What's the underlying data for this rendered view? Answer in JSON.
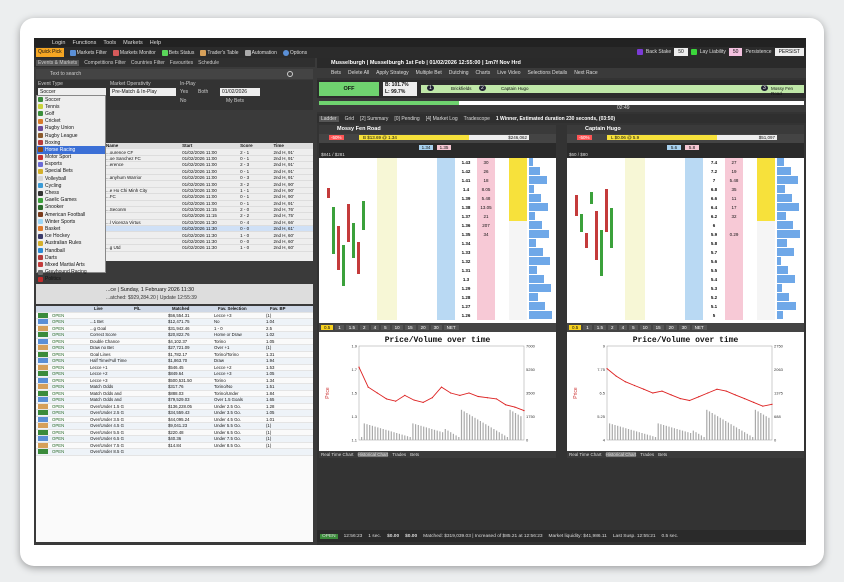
{
  "menu": [
    "Login",
    "Functions",
    "Tools",
    "Markets",
    "Help"
  ],
  "toolbar": {
    "items": [
      "Quick Pick",
      "Markets Filter",
      "Markets Monitor",
      "Bets Status",
      "Trader's Table",
      "Automation",
      "Options"
    ],
    "back_stake_label": "Back Stake",
    "back_stake": "50",
    "lay_liability_label": "Lay Liability",
    "lay_liability": "50",
    "persistence_label": "Persistence",
    "persistence": "PERSIST"
  },
  "left_tabs": [
    "Events & Markets",
    "Competitions Filter",
    "Countries Filter",
    "Favourites",
    "Schedule"
  ],
  "search_placeholder": "Text to search",
  "filters": {
    "event_type_label": "Event Type",
    "event_type": "Soccer",
    "operativity_label": "Market Operativity",
    "operativity": "Pre-Match & In-Play",
    "inplay_label": "In-Play",
    "inplay_options": [
      "Yes",
      "Both",
      "No"
    ],
    "date": "01/02/2026",
    "my_bets": "My Bets"
  },
  "event_types": [
    "Soccer",
    "Tennis",
    "Golf",
    "Cricket",
    "Rugby Union",
    "Rugby League",
    "Boxing",
    "Horse Racing",
    "Motor Sport",
    "Esports",
    "Special Bets",
    "Volleyball",
    "Cycling",
    "Chess",
    "Gaelic Games",
    "Snooker",
    "American Football",
    "Winter Sports",
    "Basket",
    "Ice Hockey",
    "Australian Rules",
    "Handball",
    "Darts",
    "Mixed Martial Arts",
    "Greyhound Racing",
    "Politics"
  ],
  "event_colors": [
    "#3b8b3b",
    "#c9d23b",
    "#3a8e3a",
    "#d87b2b",
    "#6b4a9b",
    "#8b5a2b",
    "#b83b3b",
    "#8b4513",
    "#c43131",
    "#6a6ad6",
    "#d4b02b",
    "#d6d6d6",
    "#3b9bd6",
    "#333333",
    "#3ba13b",
    "#2b6b2b",
    "#7b3b1b",
    "#9bd6f6",
    "#e07b2b",
    "#3b3b6b",
    "#d6b02b",
    "#2b8bd6",
    "#b33b3b",
    "#c43b3b",
    "#6b6b6b",
    "#c42b2b"
  ],
  "markets_table": {
    "headers": [
      "Name",
      "Start",
      "Score",
      "Time"
    ],
    "rows": [
      [
        "...ourence CF",
        "01/02/2026 11:00",
        "2 - 1",
        "2nd H, 91'"
      ],
      [
        "...oe Sanchez FC",
        "01/02/2026 11:00",
        "0 - 1",
        "2nd H, 91'"
      ],
      [
        "...erence",
        "01/02/2026 11:00",
        "2 - 3",
        "2nd H, 91'"
      ],
      [
        "",
        "01/02/2026 11:00",
        "0 - 1",
        "2nd H, 91'"
      ],
      [
        "...anyhum Warrior",
        "01/02/2026 11:00",
        "0 - 3",
        "2nd H, 91'"
      ],
      [
        "",
        "01/02/2026 11:00",
        "3 - 2",
        "2nd H, 90'"
      ],
      [
        "...e Ho Chi Minh City",
        "01/02/2026 11:00",
        "1 - 1",
        "2nd H, 90'"
      ],
      [
        "...FC",
        "01/02/2026 11:00",
        "0 - 1",
        "2nd H, 90'"
      ],
      [
        "",
        "01/02/2026 11:00",
        "0 - 1",
        "2nd H, 91'"
      ],
      [
        "...Seconm",
        "01/02/2026 11:15",
        "2 - 0",
        "2nd H, 76'"
      ],
      [
        "",
        "01/02/2026 11:15",
        "2 - 2",
        "2nd H, 75'"
      ],
      [
        "...l Vicenza Virtus",
        "01/02/2026 11:30",
        "0 - 4",
        "2nd H, 66'"
      ],
      [
        "",
        "01/02/2026 11:30",
        "0 - 0",
        "2nd H, 61'"
      ],
      [
        "",
        "01/02/2026 11:30",
        "1 - 0",
        "2nd H, 60'"
      ],
      [
        "",
        "01/02/2026 11:30",
        "0 - 0",
        "2nd H, 60'"
      ],
      [
        "...g Utd",
        "01/02/2026 11:30",
        "1 - 0",
        "2nd H, 60'"
      ]
    ]
  },
  "event_info": {
    "title": "...ce | Sunday, 1 February 2026 11:30",
    "matched": "...atched: $929,284.20 | Update 12:55:39"
  },
  "bets_table": {
    "headers": [
      "",
      "Live",
      "P/L",
      "Matched",
      "Fav. Selection",
      "Fav. BP"
    ],
    "rows": [
      [
        "OPEN",
        "",
        "",
        "$56,554.31",
        "Lecce +3",
        "(1)"
      ],
      [
        "OPEN",
        "...1 Bet",
        "",
        "$12,471.75",
        "No",
        "1.04"
      ],
      [
        "OPEN",
        "...g Goal",
        "",
        "$31,942.46",
        "1 - 0",
        "2.5"
      ],
      [
        "OPEN",
        "Correct Score",
        "",
        "$20,822.76",
        "Home or Draw",
        "1.02"
      ],
      [
        "OPEN",
        "Double Chance",
        "",
        "$4,102.37",
        "Torino",
        "1.05"
      ],
      [
        "OPEN",
        "Draw no Bet",
        "",
        "$27,721.09",
        "Over +1",
        "(1)"
      ],
      [
        "OPEN",
        "Goal Lines",
        "",
        "$1,782.17",
        "Torino/Torino",
        "1.31"
      ],
      [
        "OPEN",
        "Half Time/Full Time",
        "",
        "$1,863.70",
        "Draw",
        "1.94"
      ],
      [
        "OPEN",
        "Lecce +1",
        "",
        "$546.45",
        "Lecce +2",
        "1.53"
      ],
      [
        "OPEN",
        "Lecce +2",
        "",
        "$849.64",
        "Lecce +3",
        "1.05"
      ],
      [
        "OPEN",
        "Lecce +3",
        "",
        "$500,531.50",
        "Torino",
        "1.34"
      ],
      [
        "OPEN",
        "Match Odds",
        "",
        "$317.76",
        "Torino/No",
        "1.51"
      ],
      [
        "OPEN",
        "Match Odds and",
        "",
        "$888.03",
        "Torino/Under",
        "1.84"
      ],
      [
        "OPEN",
        "Match Odds and",
        "",
        "$79,529.03",
        "Over 1.5 Goals",
        "1.65"
      ],
      [
        "OPEN",
        "Over/Under 1.5 G",
        "",
        "$136,228.05",
        "Under 2.5 Go.",
        "1.28"
      ],
      [
        "OPEN",
        "Over/Under 2.5 G",
        "",
        "$34,559.43",
        "Under 3.5 Go.",
        "1.05"
      ],
      [
        "OPEN",
        "Over/Under 3.5 G",
        "",
        "$44,095.24",
        "Under 4.5 Go.",
        "1.01"
      ],
      [
        "OPEN",
        "Over/Under 4.5 G",
        "",
        "$9,041.23",
        "Under 5.5 Go.",
        "(1)"
      ],
      [
        "OPEN",
        "Over/Under 5.5 G",
        "",
        "$220.48",
        "Under 6.5 Go.",
        "(1)"
      ],
      [
        "OPEN",
        "Over/Under 6.5 G",
        "",
        "$40.36",
        "Under 7.5 Go.",
        "(1)"
      ],
      [
        "OPEN",
        "Over/Under 7.5 G",
        "",
        "$14.84",
        "Under 8.5 Go.",
        "(1)"
      ],
      [
        "OPEN",
        "Over/Under 8.5 G",
        "",
        "",
        "",
        ""
      ]
    ]
  },
  "race": {
    "title": "Musselburgh | Musselburgh 1st Feb | 01/02/2026 12:55:00 | 1m7f Nov Hrd",
    "tools": [
      "Bets",
      "Delete All",
      "Apply Strategy",
      "Multiple Bet",
      "Dutching",
      "Charts",
      "Live Video",
      "Selections Details",
      "Next Race"
    ],
    "status": "OFF",
    "book_back": "B: 101.7%",
    "book_lay": "L: 99.7%",
    "runners_row": [
      "1",
      "Brickfields",
      "2",
      "Captain Hugo",
      "3",
      "Mossy Fen Road"
    ],
    "time": "02:49",
    "ladder_tabs": [
      "Ladder",
      "Grid",
      "[2] Summary",
      "[0] Pending",
      "[4] Market Log",
      "Tradescope"
    ],
    "winners_info": "1 Winner, Estimated duration 230 seconds, (03:50)"
  },
  "ladders": [
    {
      "name": "Mossy Fen Road",
      "pl": "-50%",
      "bet_info": "B $13.69 @ 1.34",
      "bet_amount": "$246,062",
      "back": "1.34",
      "lay": "1.35",
      "stats": "$841 / $281",
      "prices": [
        "1.43",
        "1.42",
        "1.41",
        "1.4",
        "1.39",
        "1.38",
        "1.37",
        "1.36",
        "1.35",
        "1.34",
        "1.33",
        "1.32",
        "1.31",
        "1.3",
        "1.29",
        "1.28",
        "1.27",
        "1.26"
      ],
      "vols": [
        "30",
        "26",
        "18",
        "8.05",
        "5.48",
        "13.05",
        "21",
        "207",
        "34",
        "",
        "",
        "",
        "",
        "",
        "",
        "",
        "",
        ""
      ]
    },
    {
      "name": "Captain Hugo",
      "pl": "-50%",
      "bet_info": "L $0.06 @ 5.9",
      "bet_amount": "$51,097",
      "back": "5.6",
      "lay": "5.8",
      "stats": "$60 / $80",
      "prices": [
        "7.4",
        "7.2",
        "7",
        "6.8",
        "6.6",
        "6.4",
        "6.2",
        "6",
        "5.9",
        "5.8",
        "5.7",
        "5.6",
        "5.5",
        "5.4",
        "5.3",
        "5.2",
        "5.1",
        "5"
      ],
      "vols": [
        "27",
        "19",
        "5.48",
        "35",
        "11",
        "17",
        "32",
        "",
        "0.29",
        "",
        "",
        "",
        "",
        "",
        "",
        "",
        "",
        ""
      ]
    }
  ],
  "stakes": [
    "0.5",
    "1",
    "1.5",
    "2",
    "4",
    "5",
    "10",
    "15",
    "20",
    "30",
    "NET"
  ],
  "pv_title": "Price/Volume over time",
  "pv_ylabel": "Price",
  "pv_y2label": "Volume",
  "pv_tabs": [
    "Real Time Chart",
    "Historical Chart",
    "Trades",
    "Bets"
  ],
  "bottom": {
    "status": "OPEN",
    "clock": "12:56:23",
    "interval": "1 sec.",
    "pl1": "$0.00",
    "pl2": "$0.00",
    "matched": "Matched: $319,039.03 | Increased of $85.21 at 12:56:23",
    "liquidity": "Market liquidity: $41,986.11",
    "last_susp": "Last Susp. 12:55:21",
    "refresh": "0.5 sec."
  },
  "chart_data": [
    {
      "type": "line",
      "title": "Price/Volume over time",
      "ylabel": "Price",
      "ylim": [
        1.1,
        1.9
      ],
      "y2lim": [
        0,
        7000
      ],
      "series": [
        {
          "values": [
            1.72,
            1.55,
            1.5,
            1.45,
            1.43,
            1.48,
            1.44,
            1.42,
            1.46,
            1.55,
            1.5,
            1.48,
            1.5,
            1.47,
            1.46,
            1.45,
            1.4,
            1.38,
            1.35
          ]
        }
      ]
    },
    {
      "type": "line",
      "title": "Price/Volume over time",
      "ylabel": "Price",
      "ylim": [
        4,
        9
      ],
      "y2lim": [
        0,
        2750
      ],
      "series": [
        {
          "values": [
            7.8,
            7.4,
            7.1,
            6.9,
            6.7,
            6.5,
            6.6,
            6.4,
            6.2,
            6.1,
            6.3,
            6.5,
            6.7,
            6.6,
            6.4,
            6.2,
            6.0,
            5.8,
            5.9
          ]
        }
      ]
    }
  ]
}
